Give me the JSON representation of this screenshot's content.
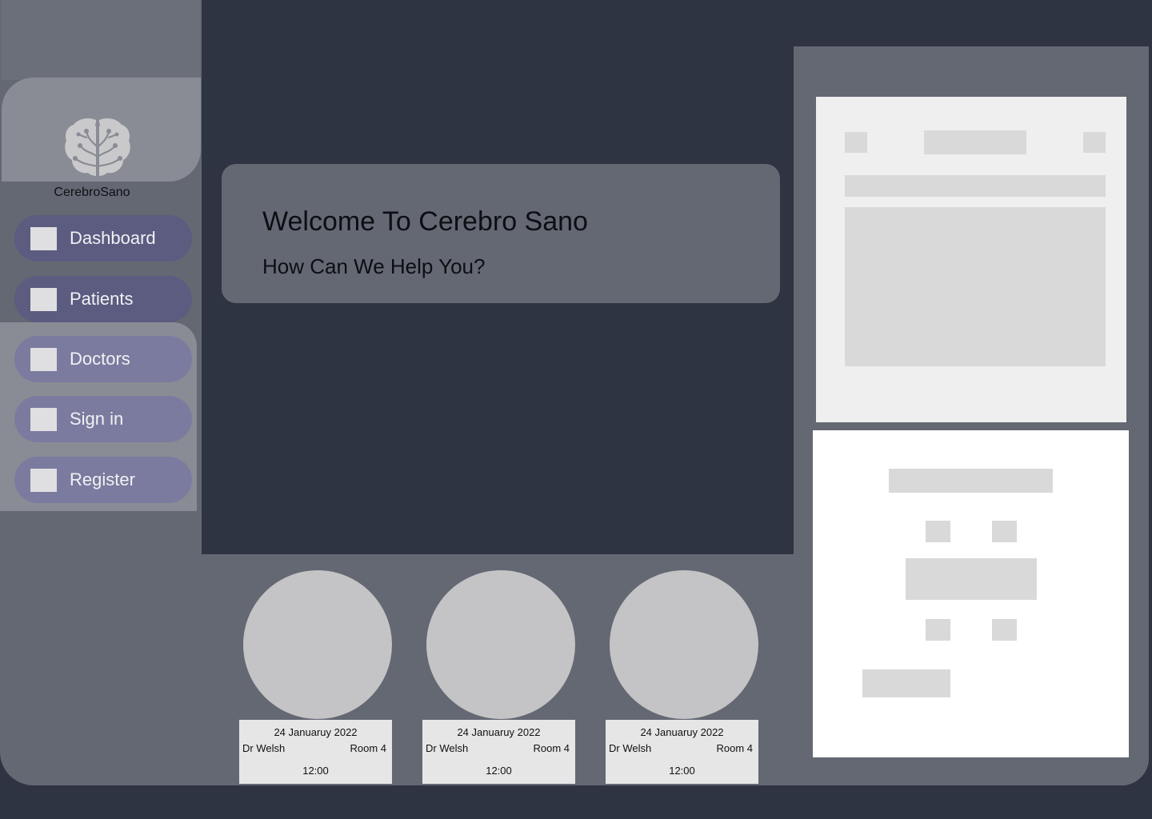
{
  "app": {
    "brand_name": "CerebroSano",
    "logo_icon": "brain-tree-icon"
  },
  "sidebar": {
    "items": [
      {
        "label": "Dashboard",
        "icon": "placeholder-icon"
      },
      {
        "label": "Patients",
        "icon": "placeholder-icon"
      },
      {
        "label": "Doctors",
        "icon": "placeholder-icon"
      },
      {
        "label": "Sign in",
        "icon": "placeholder-icon"
      },
      {
        "label": "Register",
        "icon": "placeholder-icon"
      }
    ]
  },
  "welcome": {
    "title": "Welcome To Cerebro Sano",
    "subtitle": "How Can We Help You?"
  },
  "appointments": [
    {
      "date": "24 Januaruy 2022",
      "doctor": "Dr Welsh",
      "room": "Room 4",
      "time": "12:00"
    },
    {
      "date": "24 Januaruy 2022",
      "doctor": "Dr Welsh",
      "room": "Room 4",
      "time": "12:00"
    },
    {
      "date": "24 Januaruy 2022",
      "doctor": "Dr Welsh",
      "room": "Room 4",
      "time": "12:00"
    }
  ],
  "colors": {
    "background": "#2f3442",
    "panel": "#646873",
    "nav_dark": "#5b5c80",
    "nav_light": "#7b7b9f",
    "placeholder": "#d9d9d9"
  }
}
